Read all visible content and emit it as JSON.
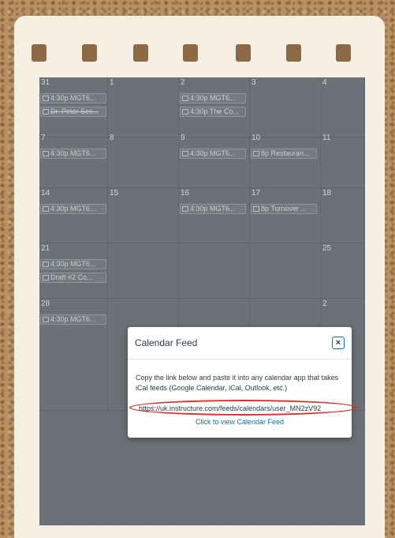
{
  "calendar": {
    "days": [
      {
        "num": "31",
        "events": [
          {
            "text": "4:30p MGT6...",
            "strike": false
          },
          {
            "text": "Dr. Peter Ses...",
            "strike": true
          }
        ]
      },
      {
        "num": "1",
        "events": []
      },
      {
        "num": "2",
        "events": [
          {
            "text": "4:30p MGT6...",
            "strike": false
          },
          {
            "text": "4:30p The Co...",
            "strike": false
          }
        ]
      },
      {
        "num": "3",
        "events": []
      },
      {
        "num": "4",
        "events": []
      },
      {
        "num": "7",
        "events": [
          {
            "text": "4:30p MGT6...",
            "strike": false
          }
        ]
      },
      {
        "num": "8",
        "events": []
      },
      {
        "num": "9",
        "events": [
          {
            "text": "4:30p MGT6...",
            "strike": false
          }
        ]
      },
      {
        "num": "10",
        "events": [
          {
            "text": "8p Restauran...",
            "strike": false
          }
        ]
      },
      {
        "num": "11",
        "events": []
      },
      {
        "num": "14",
        "events": [
          {
            "text": "4:30p MGT6...",
            "strike": false
          }
        ]
      },
      {
        "num": "15",
        "events": []
      },
      {
        "num": "16",
        "events": [
          {
            "text": "4:30p MGT6...",
            "strike": false
          }
        ]
      },
      {
        "num": "17",
        "events": [
          {
            "text": "8p Turnover ...",
            "strike": false
          }
        ]
      },
      {
        "num": "18",
        "events": []
      },
      {
        "num": "21",
        "events": [
          {
            "text": "4:30p MGT6...",
            "strike": false
          },
          {
            "text": "Draft #2 Co...",
            "strike": false
          }
        ]
      },
      {
        "num": "",
        "events": []
      },
      {
        "num": "",
        "events": []
      },
      {
        "num": "",
        "events": []
      },
      {
        "num": "25",
        "events": []
      },
      {
        "num": "28",
        "events": [
          {
            "text": "4:30p MGT6...",
            "strike": false
          }
        ]
      },
      {
        "num": "",
        "events": []
      },
      {
        "num": "",
        "events": []
      },
      {
        "num": "",
        "events": []
      },
      {
        "num": "2",
        "events": []
      }
    ]
  },
  "modal": {
    "title": "Calendar Feed",
    "close_symbol": "×",
    "description": "Copy the link below and paste it into any calendar app that takes iCal feeds (Google Calendar, iCal, Outlook, etc.)",
    "feed_url": "https://uk.instructure.com/feeds/calendars/user_MN2zV92",
    "view_link": "Click to view Calendar Feed"
  },
  "colors": {
    "highlight_oval": "#d9342b",
    "link": "#0770a3",
    "overlay_calendar": "#6b7177"
  }
}
